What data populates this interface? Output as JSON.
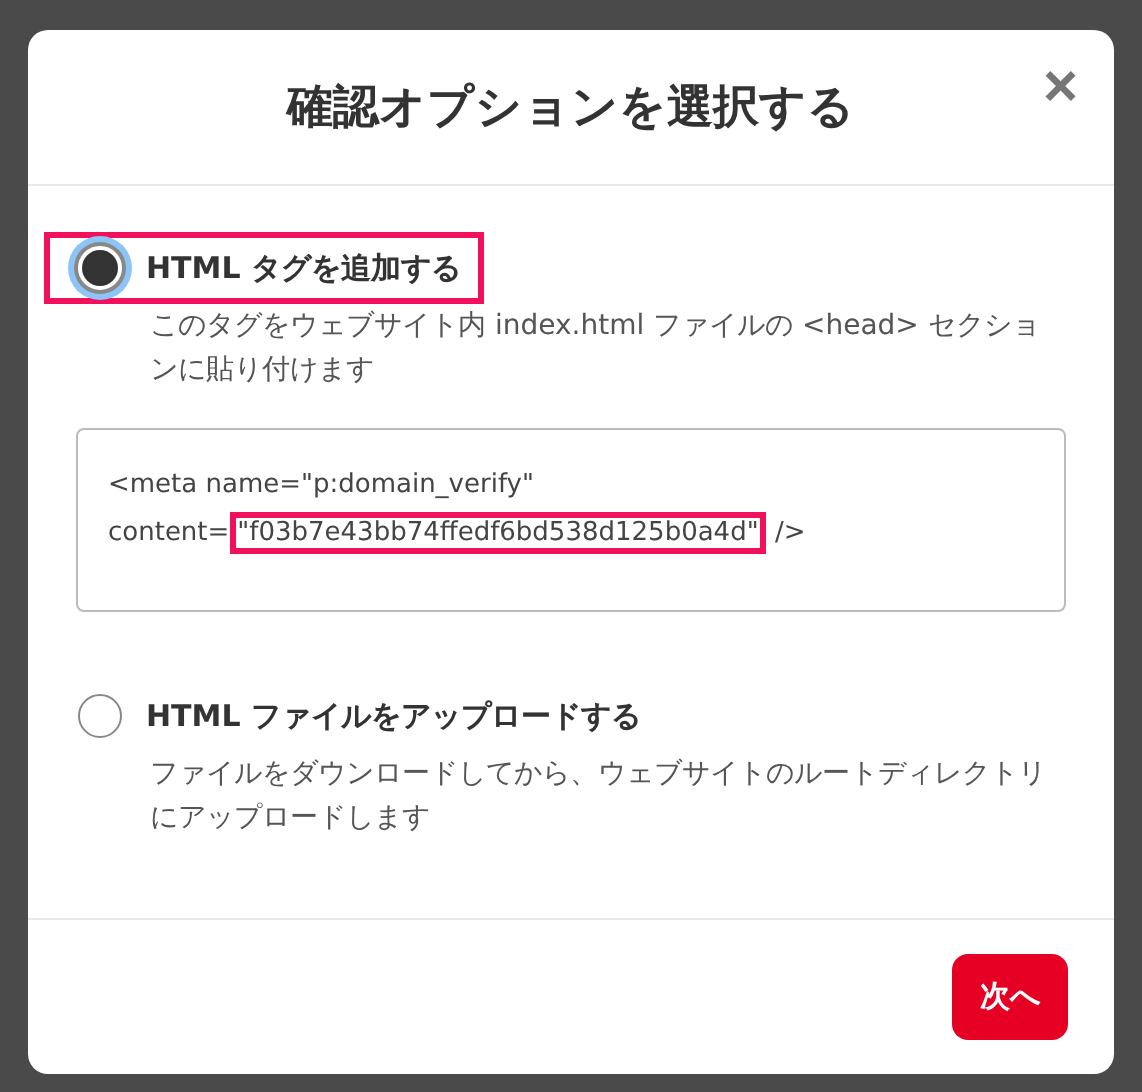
{
  "dialog": {
    "title": "確認オプションを選択する",
    "close_icon": "×"
  },
  "options": [
    {
      "label": "HTML タグを追加する",
      "description": "このタグをウェブサイト内 index.html ファイルの <head> セクションに貼り付けます",
      "selected": true,
      "highlighted": true,
      "code": {
        "line_1": "<meta name=\"p:domain_verify\"",
        "line_2_prefix": "content=",
        "line_2_value": "\"f03b7e43bb74ffedf6bd538d125b0a4d\"",
        "line_2_suffix": " />",
        "value_highlighted": true
      }
    },
    {
      "label": "HTML ファイルをアップロードする",
      "description": "ファイルをダウンロードしてから、ウェブサイトのルートディレクトリにアップロードします",
      "selected": false,
      "highlighted": false
    }
  ],
  "buttons": [
    {
      "label": "次へ",
      "kind": "primary"
    }
  ]
}
